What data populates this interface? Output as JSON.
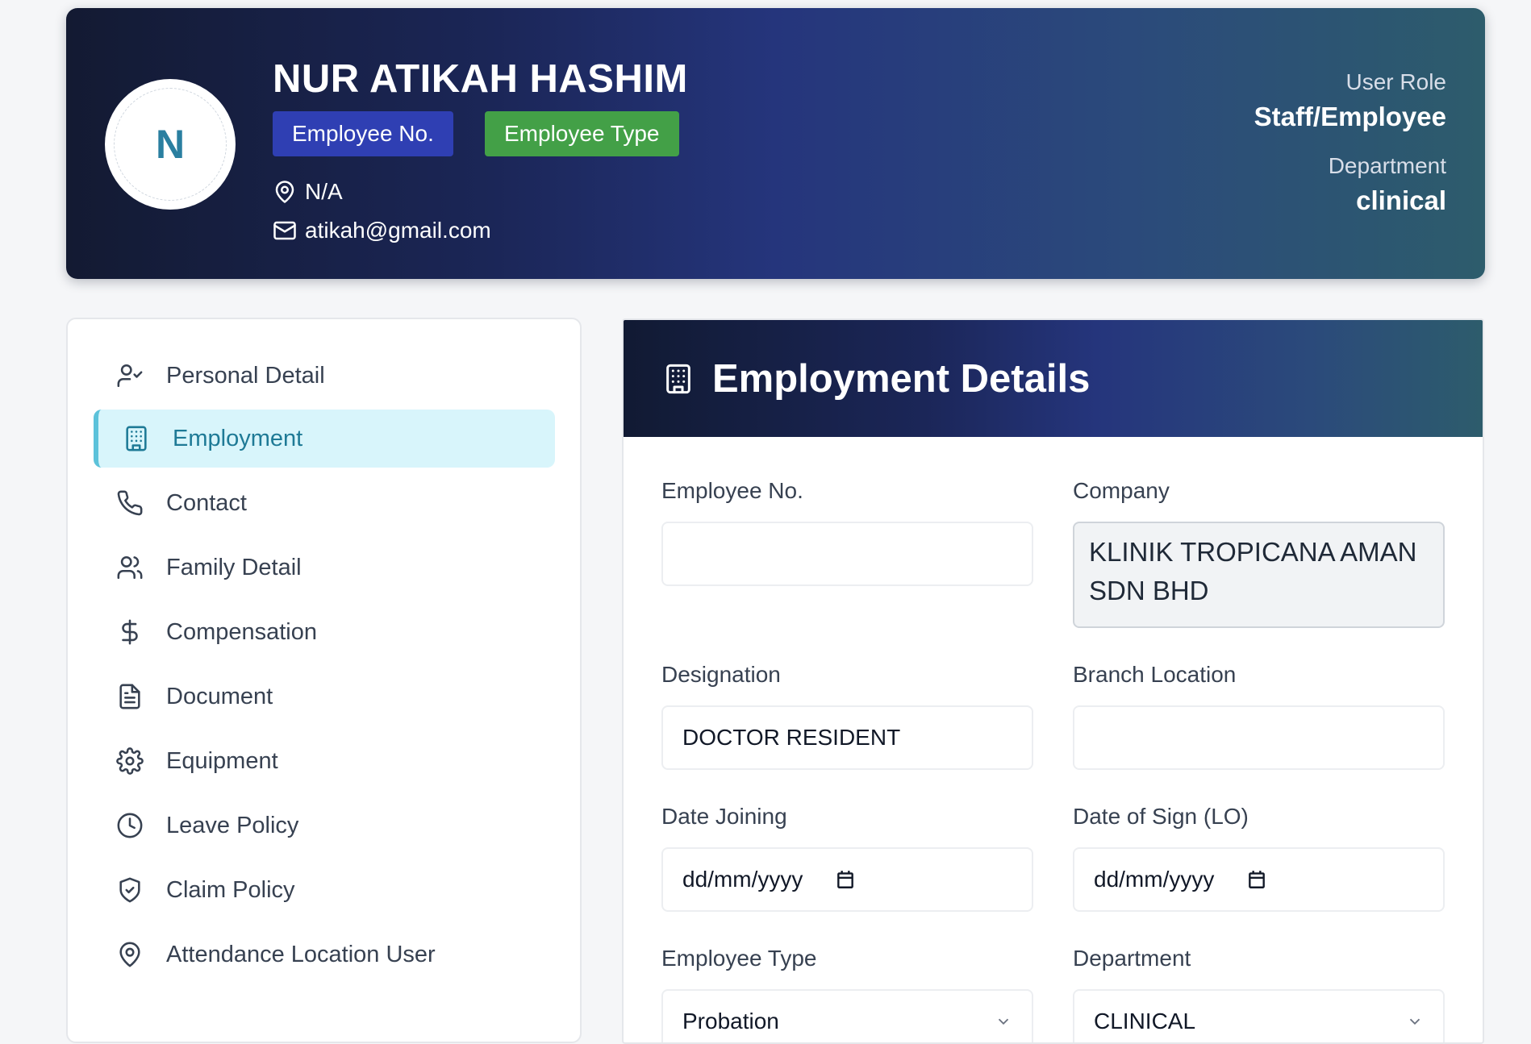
{
  "header": {
    "avatar_initial": "N",
    "name": "NUR ATIKAH HASHIM",
    "badge_employee_no": "Employee No.",
    "badge_employee_type": "Employee Type",
    "location": "N/A",
    "email": "atikah@gmail.com",
    "user_role_label": "User Role",
    "user_role_value": "Staff/Employee",
    "department_label": "Department",
    "department_value": "clinical",
    "colors": {
      "badge_no": "#2f3fb3",
      "badge_type": "#43a047",
      "avatar_text": "#2a7fa0"
    }
  },
  "sidebar": {
    "items": [
      {
        "label": "Personal Detail",
        "icon": "user-check-icon"
      },
      {
        "label": "Employment",
        "icon": "building-icon",
        "active": true
      },
      {
        "label": "Contact",
        "icon": "phone-icon"
      },
      {
        "label": "Family Detail",
        "icon": "users-icon"
      },
      {
        "label": "Compensation",
        "icon": "dollar-icon"
      },
      {
        "label": "Document",
        "icon": "file-text-icon"
      },
      {
        "label": "Equipment",
        "icon": "gear-icon"
      },
      {
        "label": "Leave Policy",
        "icon": "clock-icon"
      },
      {
        "label": "Claim Policy",
        "icon": "shield-check-icon"
      },
      {
        "label": "Attendance Location User",
        "icon": "map-pin-icon"
      }
    ]
  },
  "main": {
    "title": "Employment Details",
    "fields": {
      "employee_no": {
        "label": "Employee No.",
        "value": ""
      },
      "company": {
        "label": "Company",
        "value": "KLINIK TROPICANA AMAN SDN BHD"
      },
      "designation": {
        "label": "Designation",
        "value": "DOCTOR RESIDENT"
      },
      "branch_location": {
        "label": "Branch Location",
        "value": ""
      },
      "date_joining": {
        "label": "Date Joining",
        "placeholder": "dd/mm/yyyy"
      },
      "date_of_sign": {
        "label": "Date of Sign (LO)",
        "placeholder": "dd/mm/yyyy"
      },
      "employee_type": {
        "label": "Employee Type",
        "value": "Probation"
      },
      "department": {
        "label": "Department",
        "value": "CLINICAL"
      }
    }
  }
}
